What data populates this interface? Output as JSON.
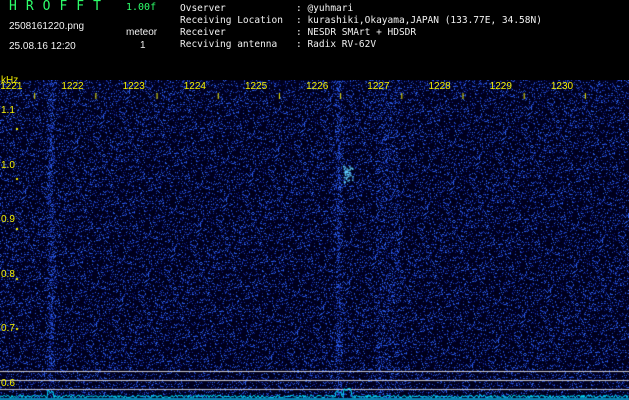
{
  "header": {
    "app_title": "HROFFT",
    "version": "1.00f",
    "filename": "2508161220.png",
    "timestamp": "25.08.16 12:20",
    "meteor_label": "meteor",
    "meteor_count": "1"
  },
  "station": [
    {
      "label": "Ovserver",
      "value": ": @yuhmari"
    },
    {
      "label": "Receiving Location",
      "value": ": kurashiki,Okayama,JAPAN (133.77E, 34.58N)"
    },
    {
      "label": "Receiver",
      "value": ": NESDR SMArt + HDSDR"
    },
    {
      "label": "Recviving antenna",
      "value": ": Radix RV-62V"
    }
  ],
  "chart_data": {
    "type": "heatmap",
    "x_unit": "Hz",
    "x_ticks": [
      "1221",
      "1222",
      "1223",
      "1224",
      "1225",
      "1226",
      "1227",
      "1228",
      "1229",
      "1230"
    ],
    "y_unit": "kHz",
    "y_ticks": [
      "1.1",
      "1.0",
      "0.9",
      "0.8",
      "0.7",
      "0.6"
    ],
    "y_range": [
      0.57,
      1.15
    ],
    "x_range": [
      1220.67,
      1230.95
    ],
    "noise_bands_hz": [
      1221.5,
      1226.2
    ],
    "meteor_echo": {
      "x_hz": 1226.35,
      "y_khz": 0.985
    },
    "colors": {
      "background": "#00001c",
      "noise": "#1a3cff",
      "hot": "#60d0ff",
      "baseline": "#00e0ff"
    }
  }
}
